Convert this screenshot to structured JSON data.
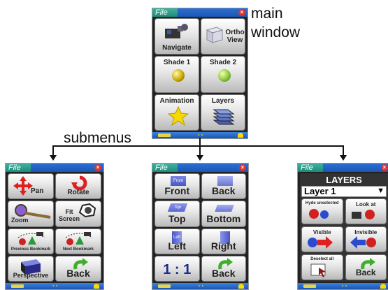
{
  "labels": {
    "main_line1": "main",
    "main_line2": "window",
    "submenus": "submenus"
  },
  "main_window": {
    "file": "File",
    "buttons": [
      "Navigate",
      "Ortho View",
      "Shade 1",
      "Shade 2",
      "Animation",
      "Layers"
    ]
  },
  "navigate_menu": {
    "file": "File",
    "buttons": [
      "Pan",
      "Rotate",
      "Zoom",
      "Fit Screen",
      "Previous Bookmark",
      "Next Bookmark",
      "Perspective",
      "Back"
    ]
  },
  "ortho_menu": {
    "file": "File",
    "buttons": [
      "Front",
      "Back",
      "Top",
      "Bottom",
      "Left",
      "Right",
      "1 : 1",
      "Back"
    ],
    "cube_labels": [
      "Front",
      "Top",
      "Left"
    ]
  },
  "layers_menu": {
    "file": "File",
    "title": "LAYERS",
    "selected_layer": "Layer 1",
    "dropdown_arrow": "▼",
    "buttons": [
      "Hyde unselected",
      "Look at",
      "Visible",
      "Invisible",
      "Deselect all",
      "Back"
    ]
  },
  "icons": [
    "close-icon",
    "pan-arrows-icon",
    "rotate-icon",
    "zoom-magnifier-icon",
    "star-icon",
    "layers-stack-icon",
    "back-arrow-icon"
  ]
}
